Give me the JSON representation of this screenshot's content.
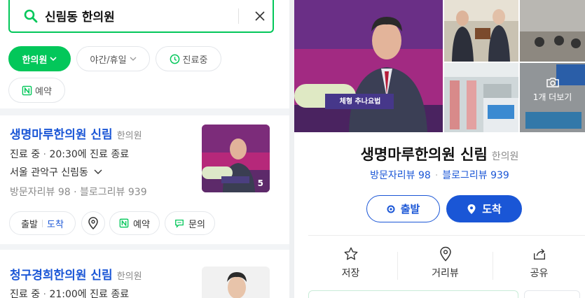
{
  "search": {
    "query": "신림동 한의원"
  },
  "filters": [
    {
      "label": "한의원",
      "active": true,
      "has_chevron": true
    },
    {
      "label": "야간/휴일",
      "active": false,
      "has_chevron": true
    },
    {
      "label": "진료중",
      "active": false,
      "icon": "clock-icon"
    },
    {
      "label": "예약",
      "active": false,
      "icon": "naver-booking-icon"
    }
  ],
  "results": [
    {
      "name": "생명마루한의원 신림",
      "category": "한의원",
      "status": "진료 중",
      "hours": "20:30에 진료 종료",
      "address": "서울 관악구 신림동",
      "visitor_reviews": "방문자리뷰 98",
      "blog_reviews": "블로그리뷰 939",
      "photo_count": "5",
      "actions": {
        "depart": "출발",
        "arrive": "도착",
        "reserve": "예약",
        "inquiry": "문의"
      }
    },
    {
      "name": "청구경희한의원 신림",
      "category": "한의원",
      "status": "진료 중",
      "hours": "21:00에 진료 종료"
    }
  ],
  "detail": {
    "name": "생명마루한의원 신림",
    "category": "한의원",
    "visitor_reviews": "방문자리뷰 98",
    "blog_reviews": "블로그리뷰 939",
    "photo_caption_text": "체형 추나요법",
    "more_photos": "1개 더보기",
    "depart": "출발",
    "arrive": "도착",
    "actions": [
      {
        "label": "저장",
        "icon": "star-icon"
      },
      {
        "label": "거리뷰",
        "icon": "location-pin-icon"
      },
      {
        "label": "공유",
        "icon": "share-icon"
      }
    ]
  },
  "colors": {
    "brand_green": "#03c75a",
    "link_blue": "#1a56d6"
  }
}
